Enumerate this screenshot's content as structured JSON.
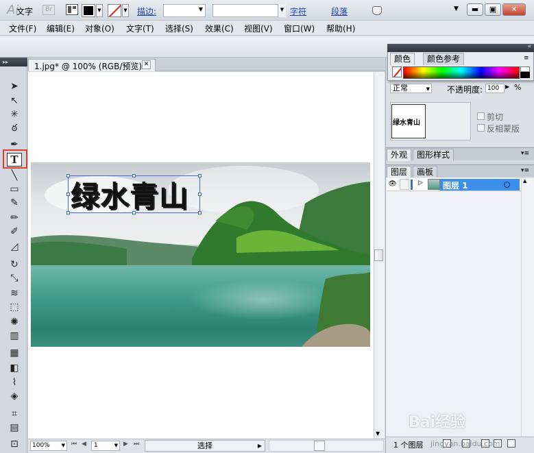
{
  "app": {
    "logo": "Ai",
    "bridge": "Br",
    "window_controls": {
      "minimize": "▬",
      "restore": "▣",
      "close": "✕"
    }
  },
  "menu": [
    "文件(F)",
    "编辑(E)",
    "对象(O)",
    "文字(T)",
    "选择(S)",
    "效果(C)",
    "视图(V)",
    "窗口(W)",
    "帮助(H)"
  ],
  "control_bar": {
    "tool_name": "文字",
    "stroke_label": "描边:",
    "char_link": "字符",
    "para_link": "段落"
  },
  "document": {
    "tab_title": "1.jpg* @ 100% (RGB/预览)",
    "close_glyph": "✕",
    "headline": "绿水青山"
  },
  "status_bar": {
    "zoom": "100%",
    "page": "1",
    "select_label": "选择"
  },
  "color_panel": {
    "tabs": [
      "颜色",
      "颜色参考"
    ],
    "menu_glyph": "≡"
  },
  "transparency_panel": {
    "blend_mode": "正常",
    "opacity_label": "不透明度:",
    "opacity_value": "100",
    "opacity_unit": "%",
    "thumb_text": "绿水青山",
    "clip_label": "剪切",
    "invert_label": "反相蒙版"
  },
  "appearance_panel": {
    "tabs": [
      "外观",
      "图形样式"
    ]
  },
  "layers_panel": {
    "tabs": [
      "图层",
      "画板"
    ],
    "layer_name": "图层 1",
    "count": "1 个图层"
  },
  "tools": [
    {
      "name": "selection-tool",
      "glyph": "➤"
    },
    {
      "name": "direct-selection-tool",
      "glyph": "↖"
    },
    {
      "name": "magic-wand-tool",
      "glyph": "✳"
    },
    {
      "name": "lasso-tool",
      "glyph": "ఠ"
    },
    {
      "name": "pen-tool",
      "glyph": "✒"
    },
    {
      "name": "type-tool",
      "glyph": "T"
    },
    {
      "name": "line-tool",
      "glyph": "╲"
    },
    {
      "name": "rectangle-tool",
      "glyph": "▭"
    },
    {
      "name": "paintbrush-tool",
      "glyph": "✎"
    },
    {
      "name": "pencil-tool",
      "glyph": "✏"
    },
    {
      "name": "blob-brush-tool",
      "glyph": "✐"
    },
    {
      "name": "eraser-tool",
      "glyph": "◿"
    },
    {
      "name": "rotate-tool",
      "glyph": "↻"
    },
    {
      "name": "scale-tool",
      "glyph": "⤡"
    },
    {
      "name": "warp-tool",
      "glyph": "≋"
    },
    {
      "name": "free-transform-tool",
      "glyph": "⬚"
    },
    {
      "name": "symbol-sprayer-tool",
      "glyph": "✺"
    },
    {
      "name": "column-graph-tool",
      "glyph": "▥"
    },
    {
      "name": "mesh-tool",
      "glyph": "▦"
    },
    {
      "name": "gradient-tool",
      "glyph": "◧"
    },
    {
      "name": "eyedropper-tool",
      "glyph": "⌇"
    },
    {
      "name": "blend-tool",
      "glyph": "◈"
    },
    {
      "name": "artboard-tool",
      "glyph": "⌗"
    },
    {
      "name": "slice-tool",
      "glyph": "▤"
    },
    {
      "name": "hand-tool",
      "glyph": "⊡"
    }
  ],
  "watermark": {
    "brand": "Bai经验",
    "url": "jingyan.baidu.com"
  },
  "colors": {
    "highlight": "#e23b30",
    "selection": "#3b6de0",
    "layer_selected": "#3d8ee8"
  }
}
